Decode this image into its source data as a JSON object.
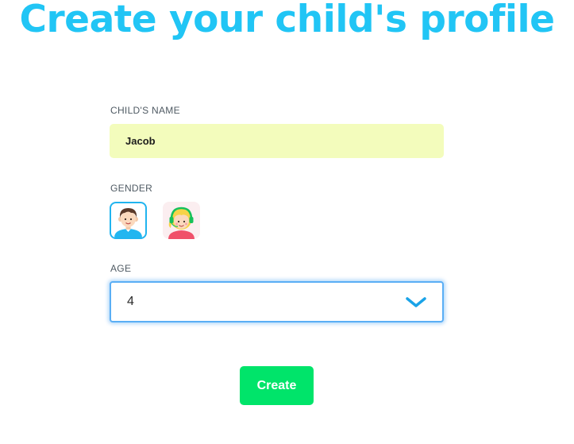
{
  "page": {
    "title": "Create your child's profile"
  },
  "form": {
    "name_label": "CHILD'S NAME",
    "name_value": "Jacob",
    "gender_label": "GENDER",
    "gender_options": [
      {
        "name": "boy",
        "icon": "boy-avatar-icon",
        "selected": true
      },
      {
        "name": "girl",
        "icon": "girl-avatar-icon",
        "selected": false
      }
    ],
    "age_label": "AGE",
    "age_value": "4",
    "age_icon": "chevron-down-icon",
    "create_label": "Create"
  },
  "colors": {
    "title": "#21c5f5",
    "name_field_bg": "#f3fcbc",
    "select_border": "#5aaef5",
    "chevron": "#1aa3e8",
    "create_button": "#00e46a"
  }
}
